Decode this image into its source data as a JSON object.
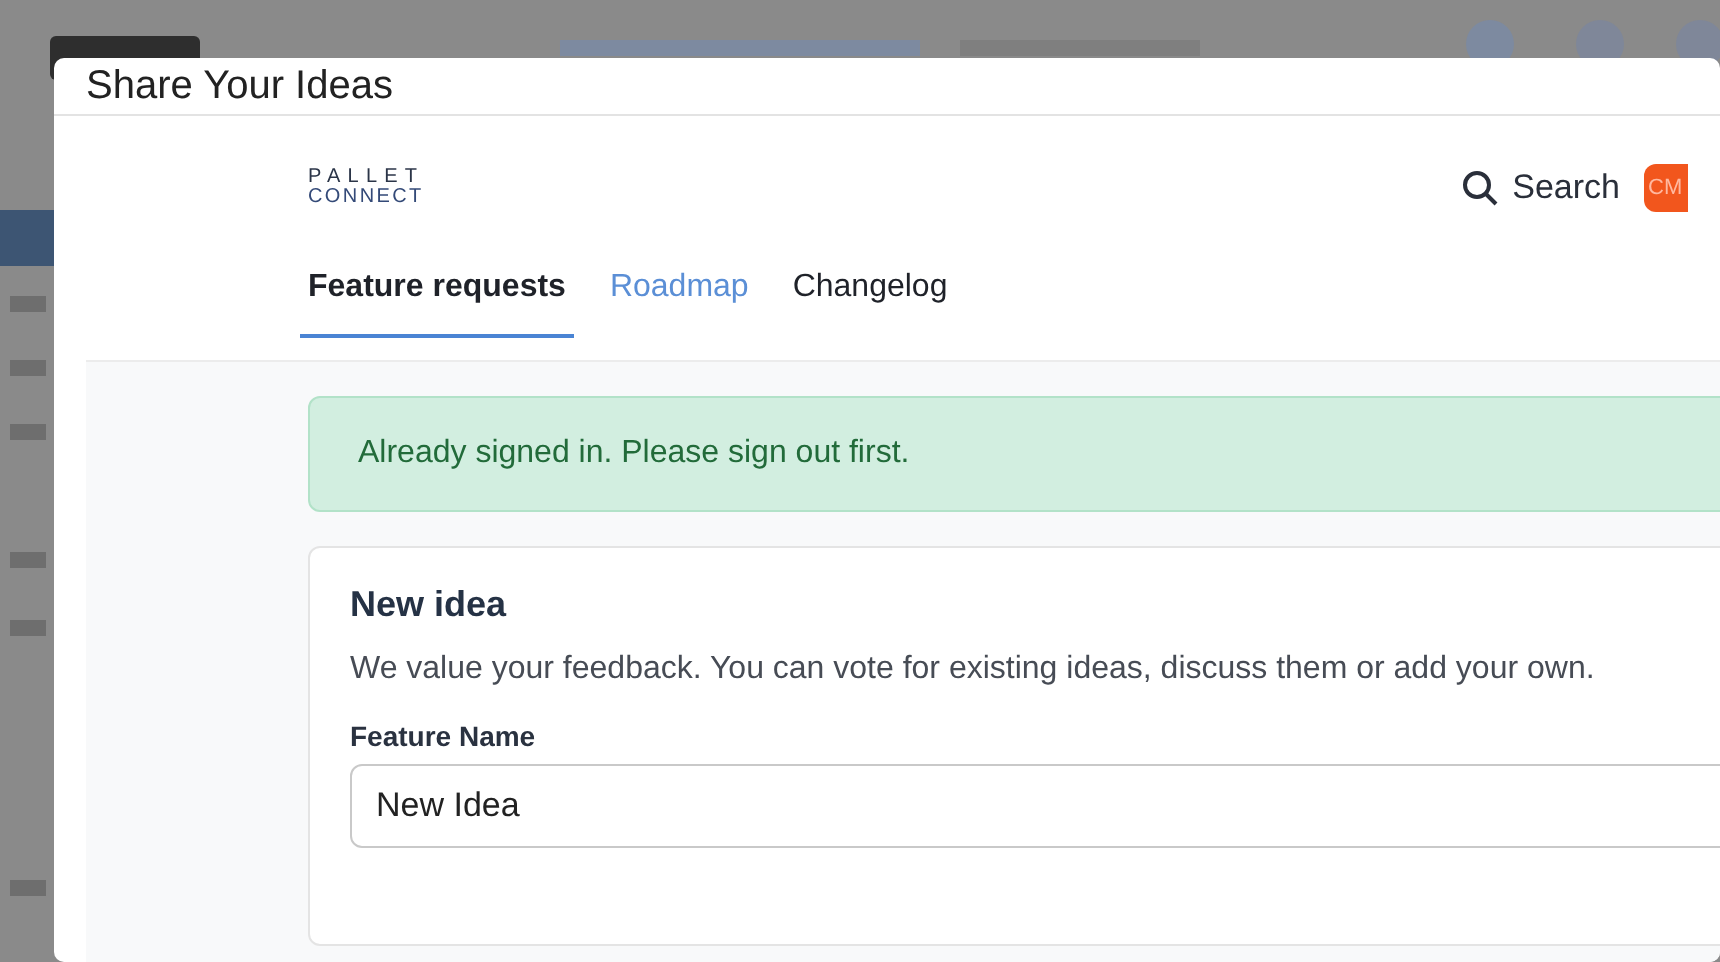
{
  "dialog": {
    "title": "Share Your Ideas"
  },
  "header": {
    "logo_top": "PALLET",
    "logo_bottom": "CONNECT",
    "search": "Search",
    "avatar": "CM"
  },
  "tabs": [
    {
      "label": "Feature requests",
      "selected": true,
      "hovered": false
    },
    {
      "label": "Roadmap",
      "selected": false,
      "hovered": true
    },
    {
      "label": "Changelog",
      "selected": false,
      "hovered": false
    }
  ],
  "alert": {
    "text": "Already signed in. Please sign out first."
  },
  "card": {
    "title": "New idea",
    "description": "We value your feedback. You can vote for existing ideas, discuss them or add your own.",
    "field_label": "Feature Name",
    "field_value": "New Idea"
  }
}
